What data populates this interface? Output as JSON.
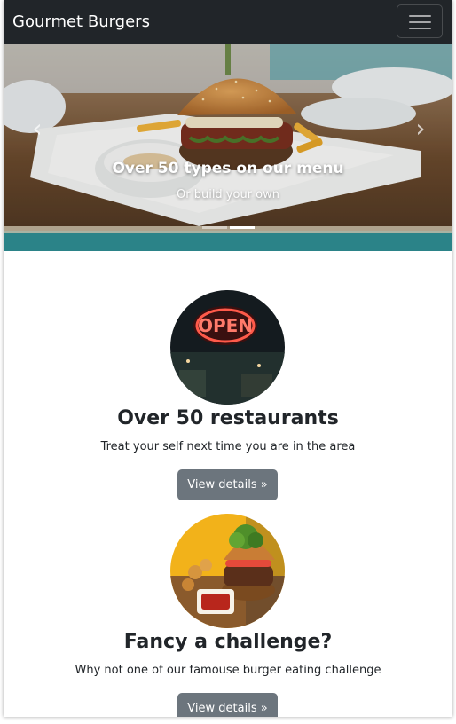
{
  "navbar": {
    "brand": "Gourmet Burgers",
    "toggler_icon": "hamburger-menu-icon"
  },
  "carousel": {
    "slides": [
      {
        "title": "Over 50 types on our menu",
        "subtitle": "Or build your own"
      }
    ],
    "indicator_count": 2,
    "active_index": 1,
    "prev_icon": "chevron-left-icon",
    "next_icon": "chevron-right-icon"
  },
  "features": [
    {
      "image": "neon-open-sign-photo",
      "title": "Over 50 restaurants",
      "text": "Treat your self next time you are in the area",
      "button": "View details »"
    },
    {
      "image": "burger-and-fries-photo",
      "title": "Fancy a challenge?",
      "text": "Why not one of our famouse burger eating challenge",
      "button": "View details »"
    }
  ],
  "colors": {
    "navbar_bg": "#212529",
    "button_bg": "#6c757d",
    "text": "#212529"
  }
}
